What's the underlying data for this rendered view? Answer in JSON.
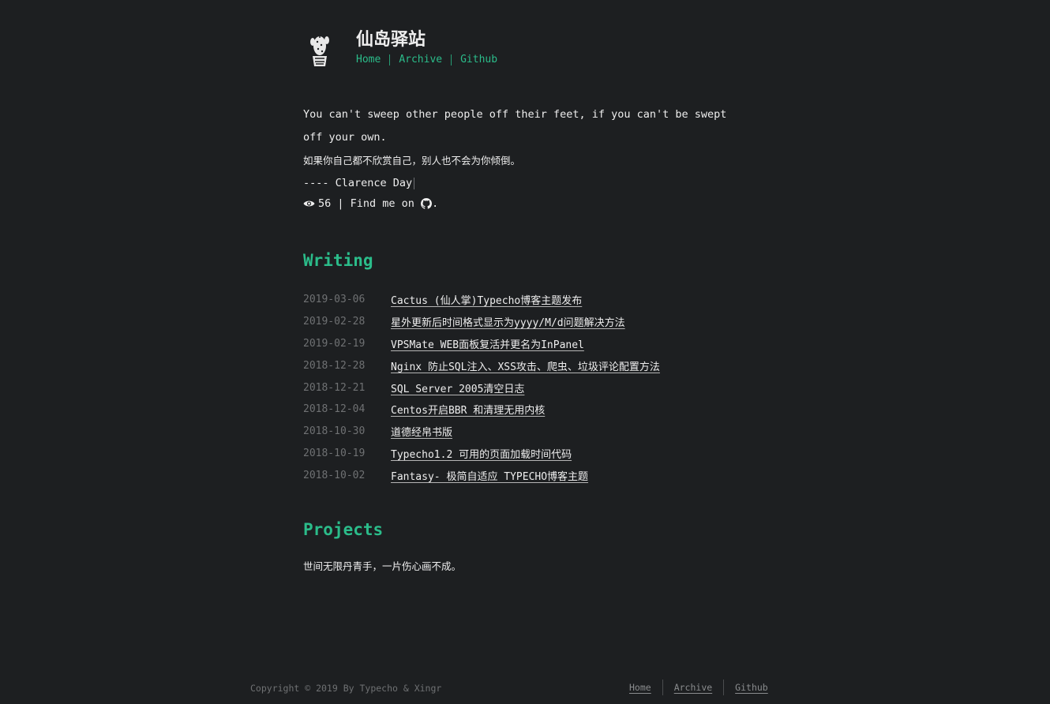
{
  "header": {
    "title": "仙岛驿站",
    "nav": [
      "Home",
      "Archive",
      "Github"
    ],
    "logo_icon": "cactus-logo-icon"
  },
  "intro": {
    "quote_en": "You can't sweep other people off their feet, if you can't be swept off your own.",
    "quote_cn": "如果你自己都不欣赏自己，别人也不会为你倾倒。",
    "author": "---- Clarence Day",
    "views": "56",
    "find_me": "| Find me on",
    "period": ".",
    "eye_icon": "eye-icon",
    "github_icon": "github-icon"
  },
  "writing": {
    "title": "Writing",
    "posts": [
      {
        "date": "2019-03-06",
        "title": "Cactus (仙人掌)Typecho博客主题发布"
      },
      {
        "date": "2019-02-28",
        "title": "星外更新后时间格式显示为yyyy/M/d问题解决方法"
      },
      {
        "date": "2019-02-19",
        "title": "VPSMate WEB面板复活并更名为InPanel"
      },
      {
        "date": "2018-12-28",
        "title": "Nginx 防止SQL注入、XSS攻击、爬虫、垃圾评论配置方法"
      },
      {
        "date": "2018-12-21",
        "title": "SQL Server 2005清空日志"
      },
      {
        "date": "2018-12-04",
        "title": "Centos开启BBR 和清理无用内核"
      },
      {
        "date": "2018-10-30",
        "title": "道德经帛书版"
      },
      {
        "date": "2018-10-19",
        "title": "Typecho1.2 可用的页面加载时间代码"
      },
      {
        "date": "2018-10-02",
        "title": "Fantasy- 极简自适应 TYPECHO博客主题"
      }
    ]
  },
  "projects": {
    "title": "Projects",
    "text": "世间无限丹青手，一片伤心画不成。"
  },
  "footer": {
    "copyright": "Copyright © 2019 By Typecho & Xingr",
    "nav": [
      "Home",
      "Archive",
      "Github"
    ]
  },
  "colors": {
    "background": "#1d1f21",
    "accent": "#2bbc8a",
    "text": "#eeeeee",
    "muted": "#6f7173"
  }
}
